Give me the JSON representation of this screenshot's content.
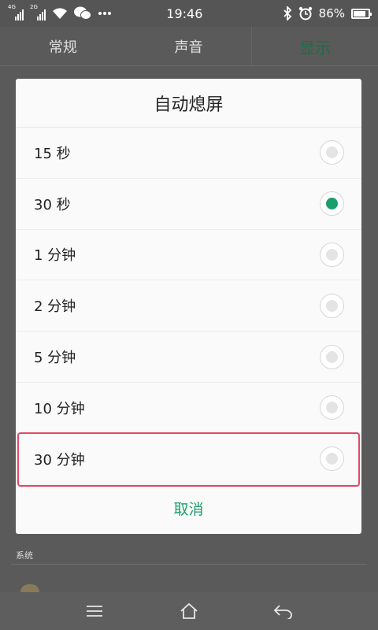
{
  "status_bar": {
    "sim1_label": "4G",
    "sim2_label": "2G",
    "wechat_icon": "wechat-icon",
    "more_icon": "more-dots-icon",
    "time": "19:46",
    "battery_percent": "86%",
    "battery_level": 0.86
  },
  "tabs": [
    {
      "label": "常规"
    },
    {
      "label": "声音"
    },
    {
      "label": "显示"
    }
  ],
  "background": {
    "section_label": "系统"
  },
  "dialog": {
    "title": "自动熄屏",
    "options": [
      {
        "label": "15 秒",
        "selected": false
      },
      {
        "label": "30 秒",
        "selected": true
      },
      {
        "label": "1 分钟",
        "selected": false
      },
      {
        "label": "2 分钟",
        "selected": false
      },
      {
        "label": "5 分钟",
        "selected": false
      },
      {
        "label": "10 分钟",
        "selected": false
      },
      {
        "label": "30 分钟",
        "selected": false
      }
    ],
    "cancel_label": "取消"
  },
  "colors": {
    "accent": "#1a9e6a",
    "highlight": "#e04a63"
  }
}
